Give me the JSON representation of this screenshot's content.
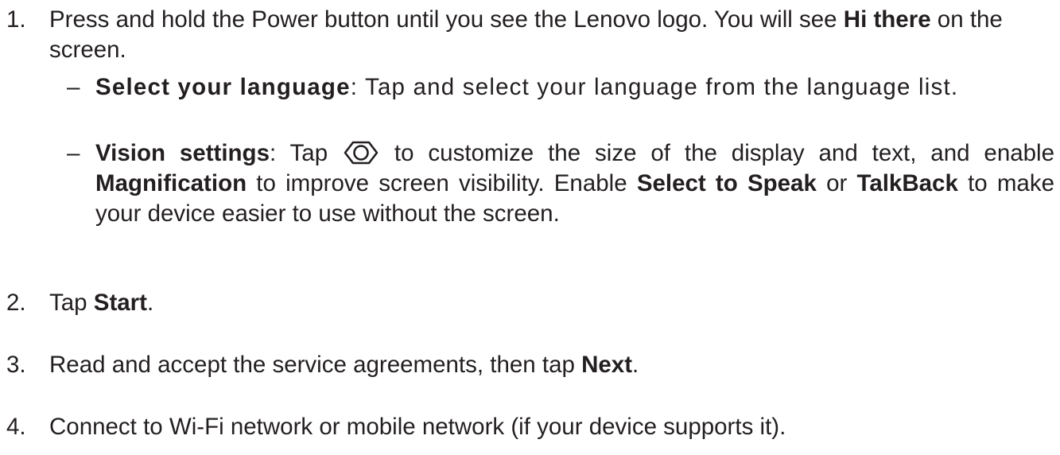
{
  "steps": [
    {
      "number": "1.",
      "text_a": "Press and hold the Power button until you see the Lenovo logo. You will see ",
      "bold_a": "Hi there",
      "text_b": " on the screen.",
      "sub_items": [
        {
          "dash": "–",
          "title": "Select your language",
          "text": ": Tap and select your language from the language list."
        },
        {
          "dash": "–",
          "title": "Vision settings",
          "text_a": ": Tap ",
          "icon": "eye-icon",
          "text_b": " to customize the size of the display and text, and enable ",
          "bold_magnification": "Magnification",
          "text_c": " to improve screen visibility. Enable ",
          "bold_select_to_speak": "Select to Speak",
          "text_d": " or ",
          "bold_talkback": "TalkBack",
          "text_e": " to make your device easier to use without the screen."
        }
      ]
    },
    {
      "number": "2.",
      "text_a": "Tap ",
      "bold_a": "Start",
      "text_b": "."
    },
    {
      "number": "3.",
      "text_a": "Read and accept the service agreements, then tap ",
      "bold_a": "Next",
      "text_b": "."
    },
    {
      "number": "4.",
      "text_a": "Connect to Wi-Fi network or mobile network (if your device supports it)."
    }
  ]
}
